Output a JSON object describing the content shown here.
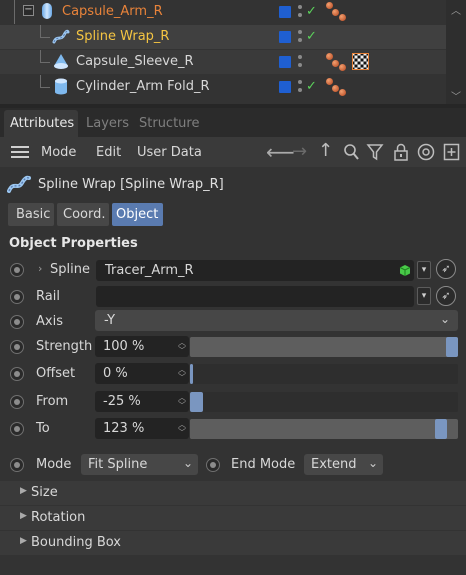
{
  "object_manager": {
    "rows": [
      {
        "name": "Capsule_Arm_R"
      },
      {
        "name": "Spline Wrap_R"
      },
      {
        "name": "Capsule_Sleeve_R"
      },
      {
        "name": "Cylinder_Arm Fold_R"
      }
    ]
  },
  "tabs": {
    "attributes": "Attributes",
    "layers": "Layers",
    "structure": "Structure"
  },
  "menu": {
    "mode": "Mode",
    "edit": "Edit",
    "user_data": "User Data"
  },
  "object_title": "Spline Wrap [Spline Wrap_R]",
  "subtabs": {
    "basic": "Basic",
    "coord": "Coord.",
    "object": "Object"
  },
  "section": "Object Properties",
  "params": {
    "spline": {
      "label": "Spline",
      "value": "Tracer_Arm_R"
    },
    "rail": {
      "label": "Rail",
      "value": ""
    },
    "axis": {
      "label": "Axis",
      "value": "-Y"
    },
    "strength": {
      "label": "Strength",
      "value": "100 %",
      "level": 1.0
    },
    "offset": {
      "label": "Offset",
      "value": "0 %",
      "level": 0.0
    },
    "from": {
      "label": "From",
      "value": "-25 %",
      "level": 0.05
    },
    "to": {
      "label": "To",
      "value": "123 %",
      "level": 0.96
    },
    "mode": {
      "label": "Mode",
      "value": "Fit Spline"
    },
    "end_mode": {
      "label": "End Mode",
      "value": "Extend"
    }
  },
  "groups": {
    "size": "Size",
    "rotation": "Rotation",
    "bounding_box": "Bounding Box"
  },
  "colors": {
    "accent": "#5a7bb0",
    "selected_name": "#f5c542",
    "orange_name": "#e8833a",
    "name_blue": "#9cc7f0"
  }
}
